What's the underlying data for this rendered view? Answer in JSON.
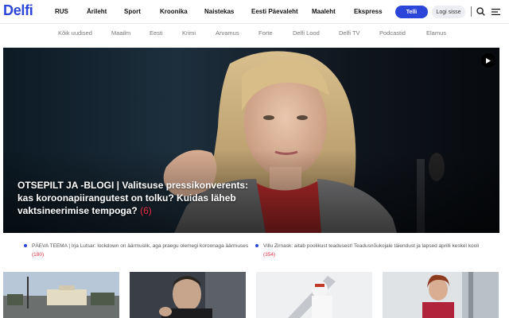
{
  "header": {
    "logo": "Delfi",
    "nav": [
      "RUS",
      "Ärileht",
      "Sport",
      "Kroonika",
      "Naistekas",
      "Eesti Päevaleht",
      "Maaleht",
      "Ekspress"
    ],
    "subscribe_label": "Telli",
    "login_label": "Logi sisse",
    "icons": [
      "search-icon",
      "menu-icon"
    ]
  },
  "subnav": [
    "Kõik uudised",
    "Maailm",
    "Eesti",
    "Krimi",
    "Arvamus",
    "Forte",
    "Delfi Lood",
    "Delfi TV",
    "Podcastid",
    "Elamus"
  ],
  "hero": {
    "title": "OTSEPILT JA -BLOGI | Valitsuse pressikonverents: kas koroonapiirangutest on tolku? Kuidas läheb vaktsineerimise tempoga?",
    "comments": "(6)",
    "icon": "play-icon"
  },
  "ticker": [
    {
      "text": "PÄEVA TEEMA | Irja Lutsar: lockdown on äärmuslik, aga praegu olemegi koroonaga äärmuses",
      "comments": "(180)"
    },
    {
      "text": "Villu Zirnask: aitab poolikust teadusest! Teadusnõukojale täiendust ja lapsed aprilli keskel kooli",
      "comments": "(354)"
    }
  ],
  "colors": {
    "brand": "#2b45d8",
    "comment_count": "#e8304a",
    "subnav_text": "#777777"
  }
}
